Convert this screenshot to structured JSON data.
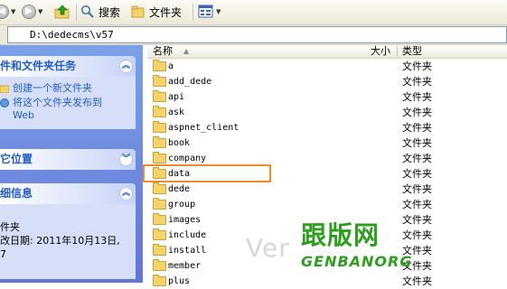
{
  "toolbar": {
    "back_icon": "back-arrow-icon",
    "forward_icon": "forward-arrow-icon",
    "up_icon": "folder-up-icon",
    "search_label": "搜索",
    "folders_label": "文件夹",
    "views_icon": "views-icon"
  },
  "address": {
    "path": "D:\\dedecms\\v57"
  },
  "left_panel": {
    "tasks": {
      "title": "件和文件夹任务",
      "items": [
        {
          "label": "创建一个新文件夹",
          "icon": "new-folder-icon"
        },
        {
          "label": "将这个文件夹发布到 Web",
          "icon": "publish-web-icon"
        }
      ]
    },
    "places": {
      "title": "它位置"
    },
    "details": {
      "title": "细信息",
      "lines": [
        "",
        "件夹",
        "改日期: 2011年10月13日,",
        "7"
      ]
    }
  },
  "columns": {
    "name": "名称",
    "size": "大小",
    "type": "类型"
  },
  "files": [
    {
      "name": "a",
      "type": "文件夹"
    },
    {
      "name": "add_dede",
      "type": "文件夹"
    },
    {
      "name": "api",
      "type": "文件夹"
    },
    {
      "name": "ask",
      "type": "文件夹"
    },
    {
      "name": "aspnet_client",
      "type": "文件夹"
    },
    {
      "name": "book",
      "type": "文件夹"
    },
    {
      "name": "company",
      "type": "文件夹"
    },
    {
      "name": "data",
      "type": "文件夹"
    },
    {
      "name": "dede",
      "type": "文件夹"
    },
    {
      "name": "group",
      "type": "文件夹"
    },
    {
      "name": "images",
      "type": "文件夹"
    },
    {
      "name": "include",
      "type": "文件夹"
    },
    {
      "name": "install",
      "type": "文件夹"
    },
    {
      "name": "member",
      "type": "文件夹"
    },
    {
      "name": "plus",
      "type": "文件夹"
    }
  ],
  "watermark": {
    "text1": "Ver",
    "text2": "跟版网",
    "url": "GENBANORG"
  },
  "colors": {
    "highlight": "#f0892a",
    "panel_blue": "#6375d6",
    "link_blue": "#215dc6",
    "watermark_green": "#2e9e1e"
  }
}
